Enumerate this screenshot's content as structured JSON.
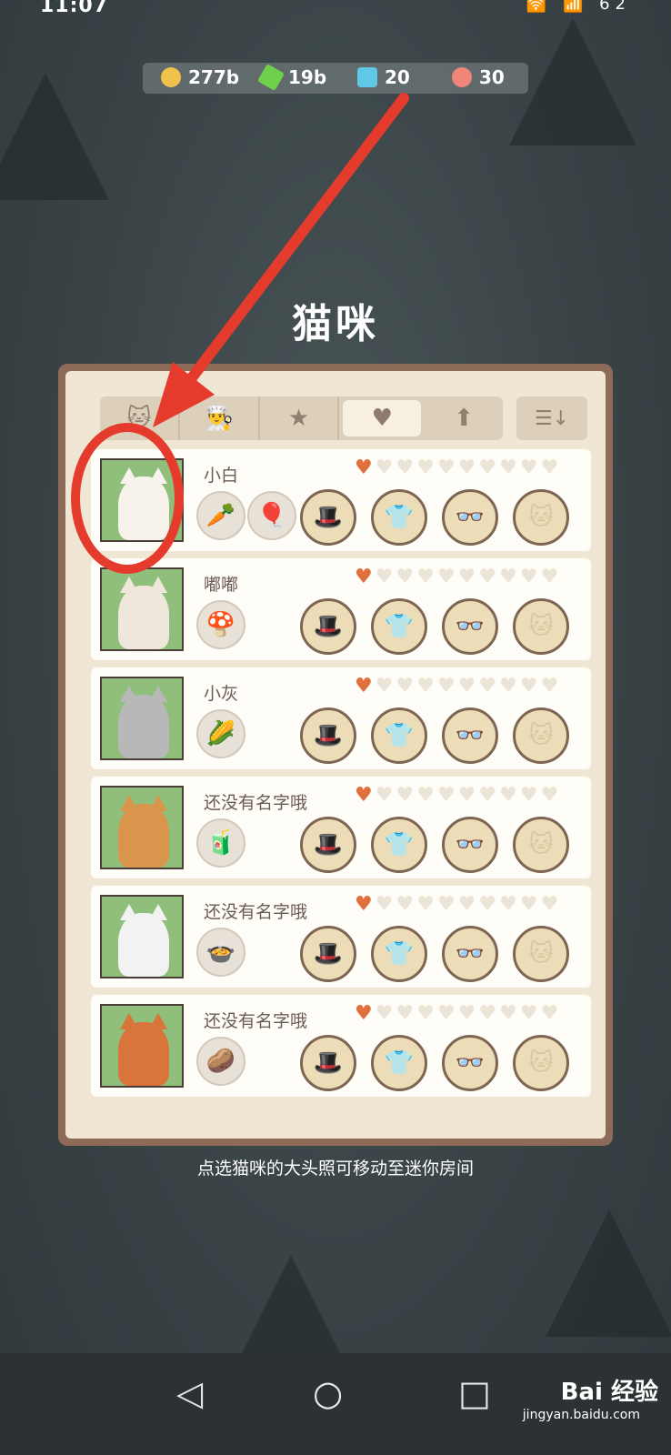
{
  "status": {
    "time": "11:07",
    "icons": "🛜 📶 62"
  },
  "currencies": [
    {
      "value": "277b",
      "icon": "coin-icon",
      "color": "#f0c24a"
    },
    {
      "value": "19b",
      "icon": "lightning-icon",
      "color": "#6fd14b"
    },
    {
      "value": "20",
      "icon": "gem-icon",
      "color": "#5ec8e6"
    },
    {
      "value": "30",
      "icon": "ticket-icon",
      "color": "#f0857a"
    }
  ],
  "title": "猫咪",
  "tabs": [
    "cat-tab",
    "chef-tab",
    "star-tab",
    "heart-tab",
    "arrow-tab"
  ],
  "cats": [
    {
      "name": "小白",
      "hearts_on": 1,
      "fur": "#f7f3ea",
      "foods": [
        "🥕",
        "🎈"
      ],
      "slots": [
        "hat",
        "shirt",
        "glasses",
        "face"
      ],
      "filled": []
    },
    {
      "name": "嘟嘟",
      "hearts_on": 1,
      "fur": "#efe7dc",
      "foods": [
        "🍄"
      ],
      "slots": [
        "hat",
        "shirt",
        "glasses",
        "face"
      ],
      "filled": [
        0
      ]
    },
    {
      "name": "小灰",
      "hearts_on": 1,
      "fur": "#b8b8b8",
      "foods": [
        "🌽"
      ],
      "slots": [
        "hat",
        "shirt",
        "glasses",
        "face"
      ],
      "filled": [
        1
      ]
    },
    {
      "name": "还没有名字哦",
      "hearts_on": 1,
      "fur": "#d9954b",
      "foods": [
        "🧃"
      ],
      "slots": [
        "hat",
        "shirt",
        "glasses",
        "face"
      ],
      "filled": []
    },
    {
      "name": "还没有名字哦",
      "hearts_on": 1,
      "fur": "#f2f2f2",
      "foods": [
        "🍲"
      ],
      "slots": [
        "hat",
        "shirt",
        "glasses",
        "face"
      ],
      "filled": []
    },
    {
      "name": "还没有名字哦",
      "hearts_on": 1,
      "fur": "#d9743b",
      "foods": [
        "🥔"
      ],
      "slots": [
        "hat",
        "shirt",
        "glasses",
        "face"
      ],
      "filled": []
    }
  ],
  "hint": "点选猫咪的大头照可移动至迷你房间",
  "watermark": {
    "brand": "Bai 经验",
    "site": "jingyan.baidu.com"
  }
}
